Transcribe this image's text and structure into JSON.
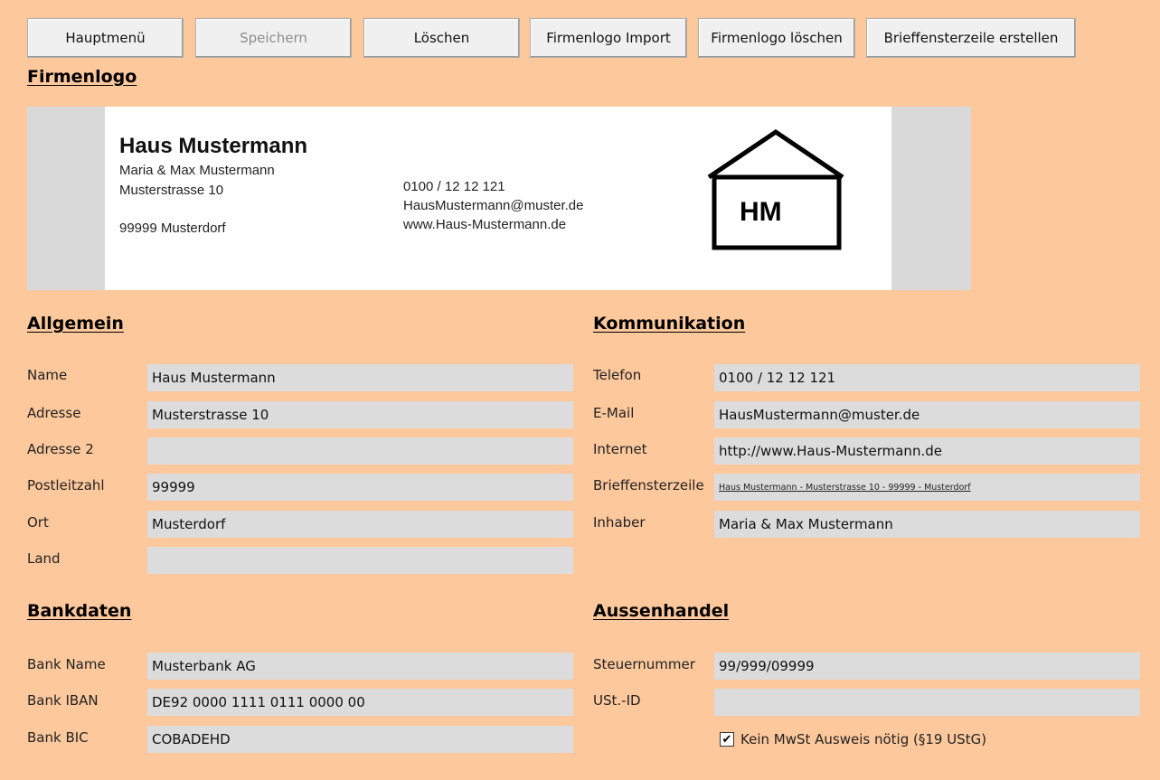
{
  "toolbar": {
    "main_menu": "Hauptmenü",
    "save": "Speichern",
    "delete": "Löschen",
    "logo_import": "Firmenlogo Import",
    "logo_delete": "Firmenlogo löschen",
    "letter_window_line": "Brieffensterzeile erstellen"
  },
  "logo_section": {
    "title": "Firmenlogo",
    "logo": {
      "company": "Haus Mustermann",
      "owners": "Maria & Max Mustermann",
      "street": "Musterstrasse 10",
      "city": "99999 Musterdorf",
      "phone": "0100 / 12 12 121",
      "email": "HausMustermann@muster.de",
      "web": "www.Haus-Mustermann.de",
      "emblem": "HM"
    }
  },
  "general": {
    "title": "Allgemein",
    "fields": [
      {
        "label": "Name",
        "value": "Haus Mustermann"
      },
      {
        "label": "Adresse",
        "value": "Musterstrasse 10"
      },
      {
        "label": "Adresse 2",
        "value": ""
      },
      {
        "label": "Postleitzahl",
        "value": "99999"
      },
      {
        "label": "Ort",
        "value": "Musterdorf"
      },
      {
        "label": "Land",
        "value": ""
      }
    ]
  },
  "communication": {
    "title": "Kommunikation",
    "fields": [
      {
        "label": "Telefon",
        "value": "0100 / 12 12 121"
      },
      {
        "label": "E-Mail",
        "value": "HausMustermann@muster.de"
      },
      {
        "label": "Internet",
        "value": "http://www.Haus-Mustermann.de"
      },
      {
        "label": "Brieffensterzeile",
        "value": "Haus Mustermann - Musterstrasse 10 - 99999 - Musterdorf"
      },
      {
        "label": "Inhaber",
        "value": "Maria & Max Mustermann"
      }
    ]
  },
  "bank": {
    "title": "Bankdaten",
    "fields": [
      {
        "label": "Bank Name",
        "value": "Musterbank AG"
      },
      {
        "label": "Bank IBAN",
        "value": "DE92 0000 1111 0111 0000 00"
      },
      {
        "label": "Bank BIC",
        "value": "COBADEHD"
      }
    ]
  },
  "foreign_trade": {
    "title": "Aussenhandel",
    "fields": [
      {
        "label": "Steuernummer",
        "value": "99/999/09999"
      },
      {
        "label": "USt.-ID",
        "value": ""
      }
    ],
    "no_vat_checkbox": {
      "label": "Kein MwSt Ausweis nötig (§19 UStG)",
      "checked": true
    }
  },
  "colors": {
    "background": "#fdc89c",
    "field": "#dcdcdc",
    "logo_frame": "#d9d9d9"
  }
}
